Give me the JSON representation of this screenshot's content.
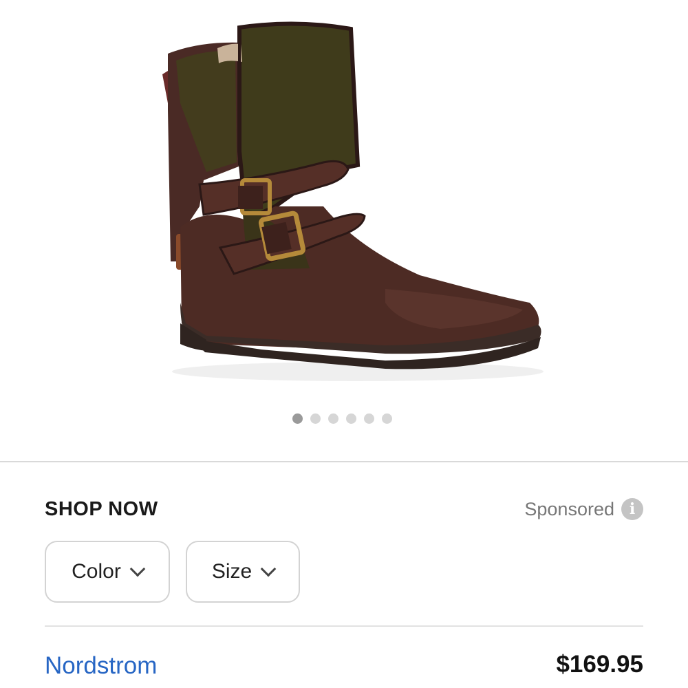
{
  "product": {
    "image_alt": "brown leather buckle boot"
  },
  "carousel": {
    "count": 6,
    "active_index": 0
  },
  "shop": {
    "title": "SHOP NOW",
    "sponsored_label": "Sponsored",
    "info_icon_glyph": "i"
  },
  "filters": {
    "color_label": "Color",
    "size_label": "Size"
  },
  "listing": {
    "merchant": "Nordstrom",
    "price": "$169.95"
  },
  "colors": {
    "merchant_link": "#2766c4",
    "boot_leather": "#4a2a22",
    "boot_canvas": "#3d3a1c",
    "buckle": "#b58a3a",
    "sole": "#3b2c27"
  },
  "icons": {
    "info": "info-icon",
    "chevron": "chevron-down-icon"
  }
}
